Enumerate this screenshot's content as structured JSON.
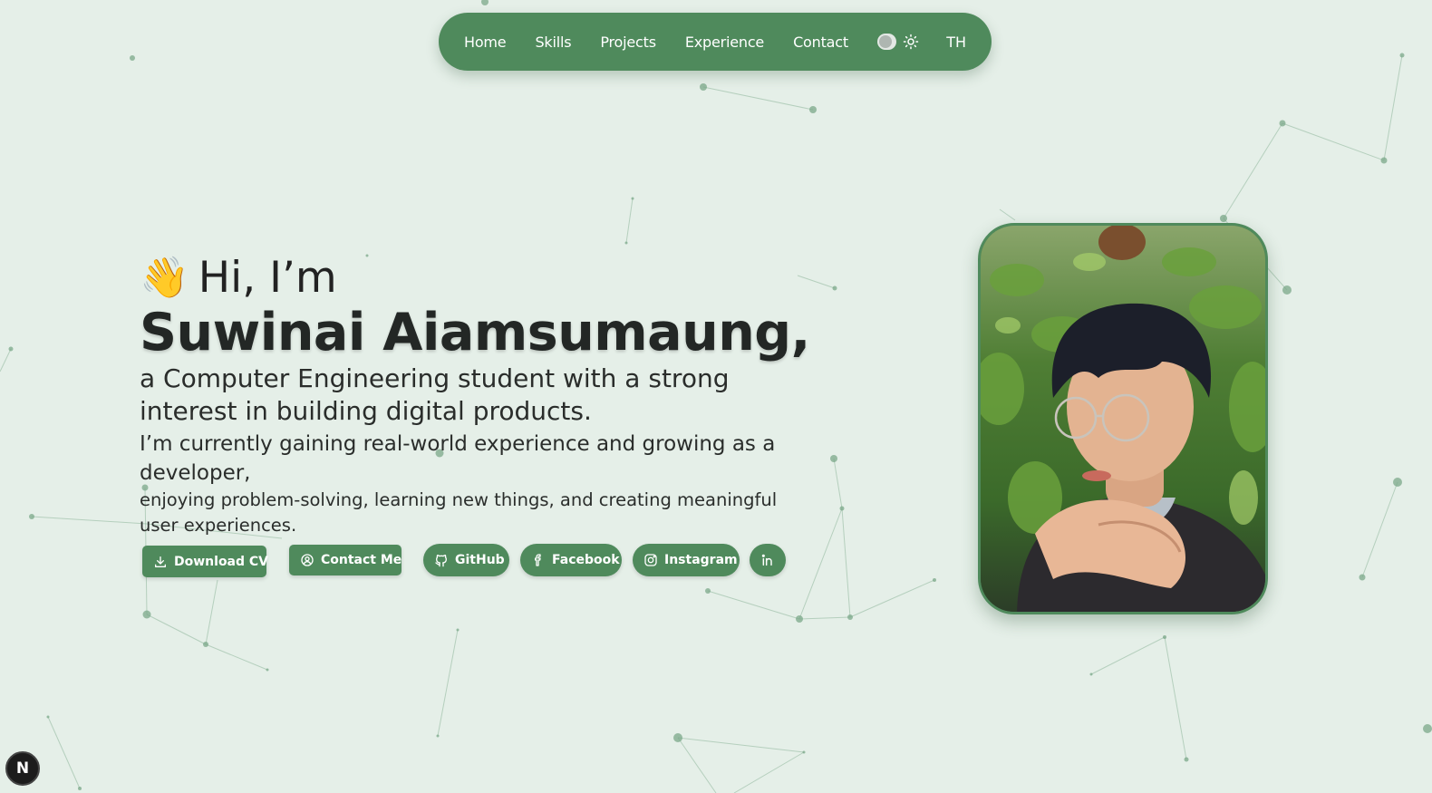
{
  "nav": {
    "items": [
      "Home",
      "Skills",
      "Projects",
      "Experience",
      "Contact"
    ],
    "theme_icon": "sun-icon",
    "lang_label": "TH"
  },
  "hero": {
    "wave_emoji": "👋",
    "greeting": "Hi, I’m",
    "name": "Suwinai Aiamsumaung,",
    "tagline": "a Computer Engineering student with a strong interest in building digital products.",
    "subline": "I’m currently gaining real-world experience and growing as a developer,",
    "subline2": "enjoying problem-solving, learning new things, and creating meaningful user experiences."
  },
  "actions": {
    "download_cv": "Download CV",
    "contact_me": "Contact Me",
    "github": "GitHub",
    "facebook": "Facebook",
    "instagram": "Instagram",
    "linkedin_icon": "linkedin-icon"
  },
  "dev_badge": "N",
  "colors": {
    "background": "#e5efe8",
    "accent": "#4f8a5c",
    "text": "#222222",
    "network": "#7ba88a"
  }
}
